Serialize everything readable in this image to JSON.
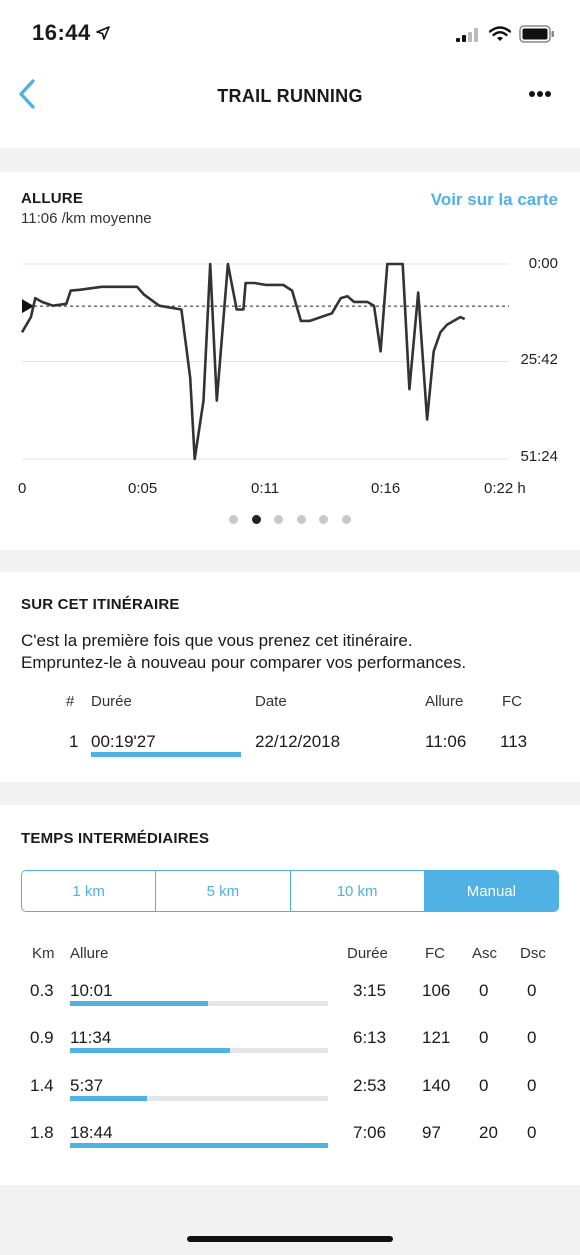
{
  "status": {
    "time": "16:44"
  },
  "header": {
    "title": "TRAIL RUNNING"
  },
  "pace_chart": {
    "title": "ALLURE",
    "subtitle": "11:06 /km moyenne",
    "map_link": "Voir sur la carte",
    "y_ticks": [
      "0:00",
      "25:42",
      "51:24"
    ],
    "x_ticks": [
      "0",
      "0:05",
      "0:11",
      "0:16",
      "0:22 h"
    ],
    "page_dots": 6,
    "active_dot": 1
  },
  "chart_data": {
    "type": "line",
    "title": "ALLURE",
    "xlabel": "h",
    "ylabel": "",
    "x_unit": "minutes",
    "y_unit": "min/km",
    "y_inverted": true,
    "xlim": [
      0,
      22
    ],
    "ylim": [
      51.4,
      0
    ],
    "average_line": 11.1,
    "series": [
      {
        "values_x": [
          0.0,
          0.4,
          0.6,
          0.9,
          1.4,
          2.0,
          2.2,
          2.6,
          3.6,
          5.2,
          5.5,
          6.2,
          7.2,
          7.6,
          7.8,
          8.2,
          8.5,
          8.8,
          9.3,
          9.7,
          10.0,
          10.1,
          10.5,
          11.0,
          11.8,
          12.2,
          12.6,
          13.0,
          13.5,
          14.0,
          14.4,
          14.7,
          15.0,
          15.6,
          15.9,
          16.2,
          16.5,
          16.8,
          17.2,
          17.5,
          17.9,
          18.3,
          18.6,
          18.9,
          19.2,
          19.5,
          19.8,
          20.0
        ],
        "values_y": [
          18.0,
          14.0,
          9.0,
          10.0,
          11.0,
          10.5,
          7.0,
          6.8,
          6.0,
          6.0,
          8.0,
          11.0,
          12.0,
          30.0,
          51.4,
          36.0,
          0.0,
          36.0,
          0.0,
          12.0,
          12.0,
          5.0,
          5.0,
          5.5,
          5.5,
          7.0,
          15.0,
          15.0,
          14.0,
          13.0,
          9.0,
          8.5,
          10.0,
          10.0,
          11.0,
          23.0,
          0.0,
          0.0,
          0.0,
          33.0,
          7.5,
          41.0,
          23.0,
          18.0,
          16.0,
          15.0,
          14.0,
          14.5
        ]
      }
    ]
  },
  "route": {
    "title": "SUR CET ITINÉRAIRE",
    "text_line1": "C'est la première fois que vous prenez cet itinéraire.",
    "text_line2": "Empruntez-le à nouveau pour comparer vos performances.",
    "headers": {
      "num": "#",
      "duration": "Durée",
      "date": "Date",
      "pace": "Allure",
      "hr": "FC"
    },
    "rows": [
      {
        "num": "1",
        "duration": "00:19'27",
        "date": "22/12/2018",
        "pace": "11:06",
        "hr": "113",
        "bar_fraction": 1.0
      }
    ]
  },
  "splits": {
    "title": "TEMPS INTERMÉDIAIRES",
    "tabs": [
      "1 km",
      "5 km",
      "10 km",
      "Manual"
    ],
    "active_tab": 3,
    "headers": {
      "km": "Km",
      "pace": "Allure",
      "duration": "Durée",
      "hr": "FC",
      "asc": "Asc",
      "dsc": "Dsc"
    },
    "rows": [
      {
        "km": "0.3",
        "pace": "10:01",
        "duration": "3:15",
        "hr": "106",
        "asc": "0",
        "dsc": "0",
        "bar_fraction": 0.535
      },
      {
        "km": "0.9",
        "pace": "11:34",
        "duration": "6:13",
        "hr": "121",
        "asc": "0",
        "dsc": "0",
        "bar_fraction": 0.62
      },
      {
        "km": "1.4",
        "pace": "5:37",
        "duration": "2:53",
        "hr": "140",
        "asc": "0",
        "dsc": "0",
        "bar_fraction": 0.3
      },
      {
        "km": "1.8",
        "pace": "18:44",
        "duration": "7:06",
        "hr": "97",
        "asc": "20",
        "dsc": "0",
        "bar_fraction": 1.0
      }
    ]
  },
  "colors": {
    "accent": "#4fb1e4",
    "track": "#e6e6ea",
    "line": "#333333"
  }
}
